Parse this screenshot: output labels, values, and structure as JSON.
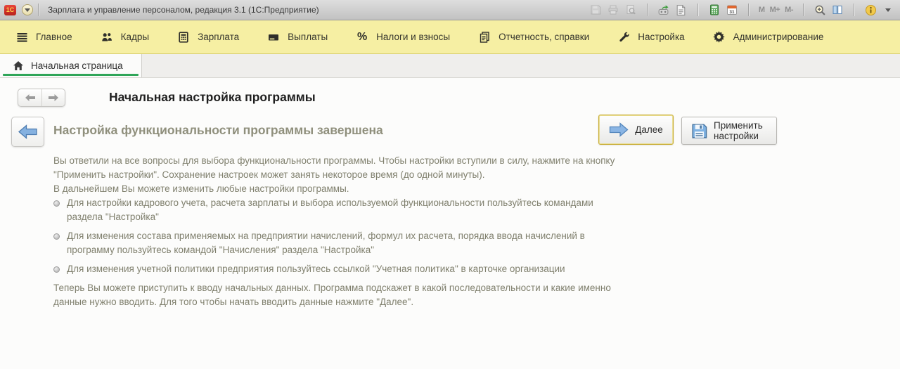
{
  "title_bar": {
    "logo": "1С",
    "title": "Зарплата и управление персоналом, редакция 3.1  (1С:Предприятие)",
    "calendar_day": "31",
    "memory": [
      "M",
      "M+",
      "M-"
    ],
    "icons": [
      "save-icon",
      "print-icon",
      "print-preview-icon",
      "go-to-link-icon",
      "export-page-icon",
      "calculator-icon",
      "calendar-icon",
      "zoom-in-icon",
      "split-view-icon",
      "info-icon",
      "dropdown-caret-icon"
    ]
  },
  "ribbon": {
    "items": [
      {
        "label": "Главное",
        "icon": "menu-lines-icon"
      },
      {
        "label": "Кадры",
        "icon": "people-icon"
      },
      {
        "label": "Зарплата",
        "icon": "calculator-icon"
      },
      {
        "label": "Выплаты",
        "icon": "payment-card-icon"
      },
      {
        "label": "Налоги и взносы",
        "icon": "percent-icon",
        "glyph": "%"
      },
      {
        "label": "Отчетность, справки",
        "icon": "report-icon"
      },
      {
        "label": "Настройка",
        "icon": "wrench-icon"
      },
      {
        "label": "Администрирование",
        "icon": "gear-icon"
      }
    ]
  },
  "tabs": [
    {
      "label": "Начальная страница",
      "icon": "home-icon",
      "active": true
    }
  ],
  "page": {
    "title": "Начальная настройка программы",
    "heading": "Настройка функциональности программы завершена",
    "buttons": {
      "next": "Далее",
      "apply": "Применить настройки"
    },
    "paragraph1": "Вы ответили на все вопросы для выбора функциональности программы. Чтобы настройки вступили в силу, нажмите на кнопку \"Применить настройки\". Сохранение настроек может занять некоторое время (до одной минуты).",
    "paragraph2": "В дальнейшем Вы можете изменить любые настройки программы.",
    "bullets": [
      "Для настройки кадрового учета, расчета зарплаты и выбора используемой функциональности пользуйтесь командами раздела \"Настройка\"",
      "Для изменения состава применяемых на предприятии начислений, формул их расчета, порядка ввода начислений в программу пользуйтесь командой \"Начисления\" раздела \"Настройка\"",
      "Для изменения учетной политики предприятия пользуйтесь ссылкой \"Учетная политика\" в карточке организации"
    ],
    "final_paragraph": "Теперь Вы можете приступить к вводу начальных данных. Программа подскажет в какой последовательности и какие именно данные нужно вводить. Для того чтобы начать вводить данные нажмите \"Далее\"."
  },
  "colors": {
    "ribbon_bg": "#f6efa3",
    "tab_underline_green": "#2fa558",
    "focus_button_border": "#c9ae35",
    "arrow_blue": "#8ab5e4",
    "body_text": "#80806e",
    "heading_text": "#8f8f7c"
  }
}
